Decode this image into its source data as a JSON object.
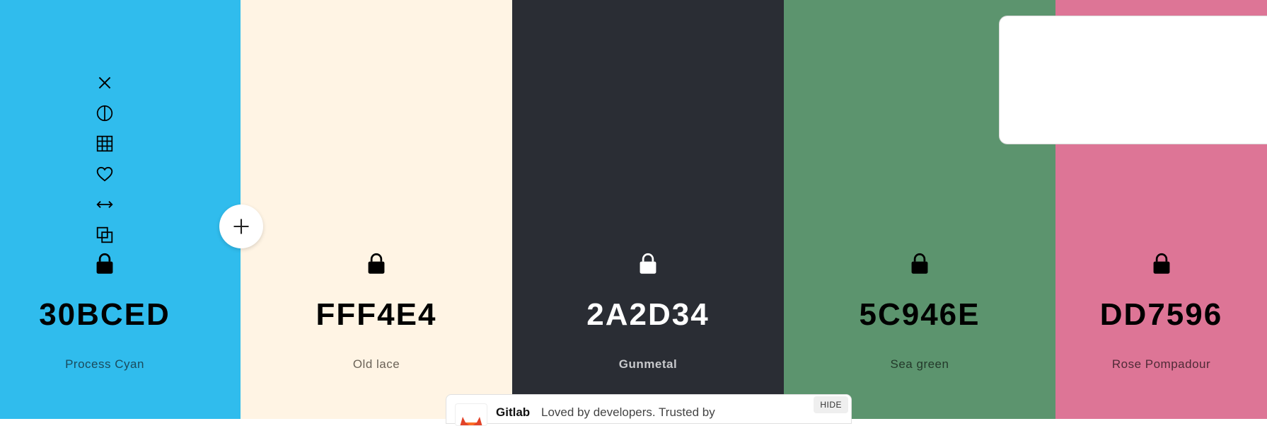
{
  "palette": {
    "colors": [
      {
        "hex": "30BCED",
        "name": "Process Cyan",
        "bg": "#30BCED",
        "text_color": "#000000",
        "name_color": "#1a4a5c",
        "icon_color": "#000000"
      },
      {
        "hex": "FFF4E4",
        "name": "Old lace",
        "bg": "#FFF4E4",
        "text_color": "#000000",
        "name_color": "#6b6358",
        "icon_color": "#000000"
      },
      {
        "hex": "2A2D34",
        "name": "Gunmetal",
        "bg": "#2A2D34",
        "text_color": "#ffffff",
        "name_color": "#c8c9cc",
        "icon_color": "#ffffff"
      },
      {
        "hex": "5C946E",
        "name": "Sea green",
        "bg": "#5C946E",
        "text_color": "#000000",
        "name_color": "#23392a",
        "icon_color": "#000000"
      },
      {
        "hex": "DD7596",
        "name": "Rose Pompadour",
        "bg": "#DD7596",
        "text_color": "#000000",
        "name_color": "#4f2a36",
        "icon_color": "#000000"
      }
    ]
  },
  "toolbar": {
    "tools": [
      {
        "icon": "close-icon"
      },
      {
        "icon": "contrast-icon"
      },
      {
        "icon": "grid-shades-icon"
      },
      {
        "icon": "heart-icon"
      },
      {
        "icon": "drag-arrows-icon"
      },
      {
        "icon": "copy-icon"
      }
    ]
  },
  "add_button": {
    "icon": "plus-icon"
  },
  "ad": {
    "brand": "Gitlab",
    "text": "Loved by developers. Trusted by",
    "hide_label": "HIDE",
    "logo_icon": "gitlab-logo-icon"
  }
}
